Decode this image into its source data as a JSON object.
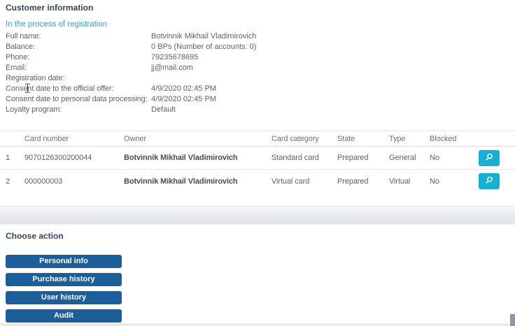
{
  "page": {
    "title": "Customer information",
    "status": "In the process of registration"
  },
  "info": {
    "rows": [
      {
        "label": "Full name:",
        "value": "Botvinnik Mikhail Vladimirovich"
      },
      {
        "label": "Balance:",
        "value": "0 BPs (Number of accounts: 0)"
      },
      {
        "label": "Phone:",
        "value": "79235678695"
      },
      {
        "label": "Email:",
        "value": "jj@mail.com"
      },
      {
        "label": "Registration date:",
        "value": ""
      },
      {
        "label": "Consent date to the official offer:",
        "value": "4/9/2020 02:45 PM"
      },
      {
        "label": "Consent date to personal data processing:",
        "value": "4/9/2020 02:45 PM"
      },
      {
        "label": "Loyalty program:",
        "value": "Default"
      }
    ]
  },
  "cards_table": {
    "columns": [
      "Card number",
      "Owner",
      "Card category",
      "State",
      "Type",
      "Blocked"
    ],
    "rows": [
      {
        "index": "1",
        "card_number": "9070126300200044",
        "owner": "Botvinnik Mikhail Vladimirovich",
        "category": "Standard card",
        "state": "Prepared",
        "type": "General",
        "blocked": "No",
        "action_icon": "search-icon"
      },
      {
        "index": "2",
        "card_number": "000000003",
        "owner": "Botvinnik Mikhail Vladimirovich",
        "category": "Virtual card",
        "state": "Prepared",
        "type": "Virtual",
        "blocked": "No",
        "action_icon": "search-icon"
      }
    ]
  },
  "actions": {
    "title": "Choose action",
    "buttons": [
      "Personal info",
      "Purchase history",
      "User history",
      "Audit"
    ]
  },
  "colors": {
    "heading": "#33475b",
    "body_text": "#5a646e",
    "status_teal": "#2aa7c6",
    "search_button": "#18b0d2",
    "action_button": "#1b5e99",
    "divider": "#e6e6e6",
    "footer_band": "#e1e4eb",
    "scroll_thumb": "#8d96af"
  }
}
